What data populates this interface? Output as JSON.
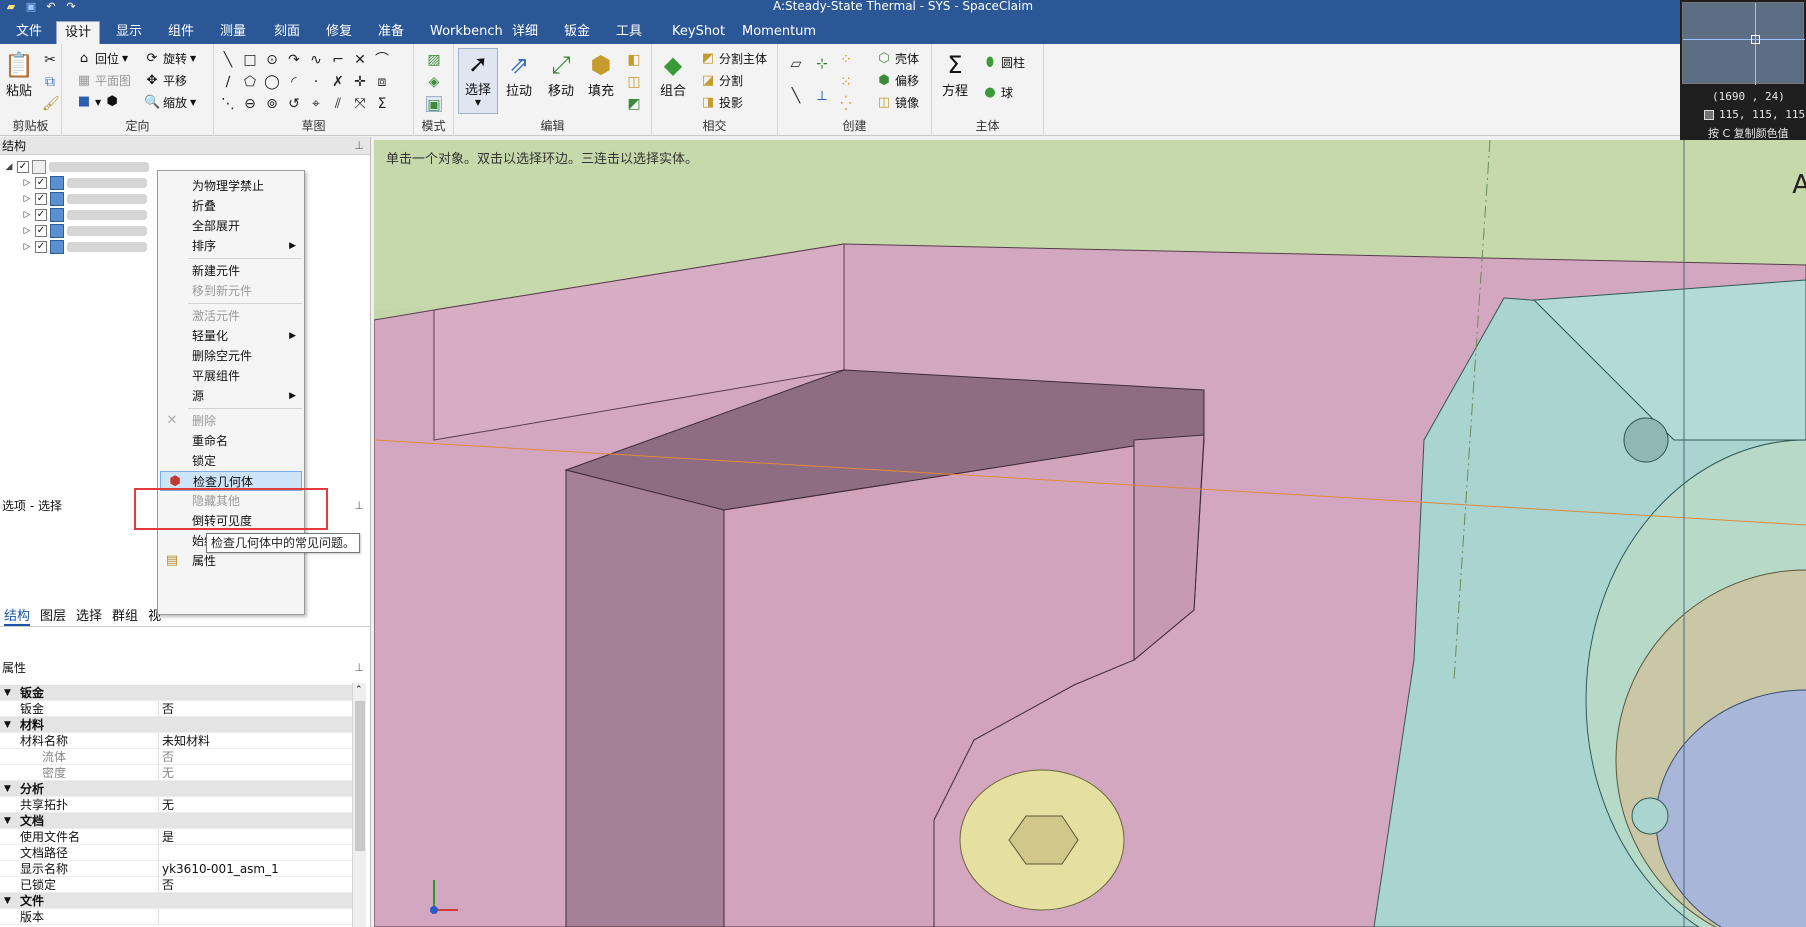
{
  "window": {
    "title": "A:Steady-State Thermal - SYS - SpaceClaim"
  },
  "ribbon_tabs": [
    "文件",
    "设计",
    "显示",
    "组件",
    "测量",
    "刻面",
    "修复",
    "准备",
    "Workbench",
    "详细",
    "钣金",
    "工具",
    "KeyShot",
    "Momentum"
  ],
  "active_tab": "设计",
  "ribbon": {
    "clipboard": {
      "caption": "剪贴板",
      "paste": "粘贴"
    },
    "orient": {
      "caption": "定向",
      "home": "回位",
      "plane": "平面图",
      "rotate": "旋转",
      "pan": "平移",
      "zoom": "缩放"
    },
    "sketch": {
      "caption": "草图"
    },
    "mode": {
      "caption": "模式"
    },
    "edit": {
      "caption": "编辑",
      "select": "选择",
      "pull": "拉动",
      "move": "移动",
      "fill": "填充"
    },
    "intersect": {
      "caption": "相交",
      "combine": "组合",
      "split_body": "分割主体",
      "split": "分割",
      "project": "投影"
    },
    "create": {
      "caption": "创建",
      "shell": "壳体",
      "offset": "偏移",
      "mirror": "镜像"
    },
    "body": {
      "caption": "主体",
      "equation": "方程",
      "cylinder": "圆柱",
      "sphere": "球"
    }
  },
  "inset": {
    "coords": "(1690 , 24)",
    "color_value": "115, 115, 115",
    "copy_hint": "按 C 复制颜色值"
  },
  "structure_panel": {
    "title": "结构",
    "pin": "⊥"
  },
  "panel_tabs": [
    "结构",
    "图层",
    "选择",
    "群组",
    "视"
  ],
  "options_panel": {
    "title": "选项 - 选择"
  },
  "properties_panel": {
    "title": "属性",
    "rows": [
      {
        "type": "cat",
        "k": "钣金",
        "v": ""
      },
      {
        "type": "row",
        "k": "钣金",
        "v": "否"
      },
      {
        "type": "cat",
        "k": "材料",
        "v": ""
      },
      {
        "type": "row",
        "k": "材料名称",
        "v": "未知材料"
      },
      {
        "type": "dim",
        "k": "流体",
        "v": "否"
      },
      {
        "type": "dim",
        "k": "密度",
        "v": "无"
      },
      {
        "type": "cat",
        "k": "分析",
        "v": ""
      },
      {
        "type": "row",
        "k": "共享拓扑",
        "v": "无"
      },
      {
        "type": "cat",
        "k": "文档",
        "v": ""
      },
      {
        "type": "row",
        "k": "使用文件名",
        "v": "是"
      },
      {
        "type": "row",
        "k": "文档路径",
        "v": ""
      },
      {
        "type": "row",
        "k": "显示名称",
        "v": "yk3610-001_asm_1"
      },
      {
        "type": "row",
        "k": "已锁定",
        "v": "否"
      },
      {
        "type": "cat",
        "k": "文件",
        "v": ""
      },
      {
        "type": "row",
        "k": "版本",
        "v": ""
      }
    ]
  },
  "viewport": {
    "hint": "单击一个对象。双击以选择环边。三连击以选择实体。",
    "corner": "A"
  },
  "context_menu": {
    "items": [
      {
        "label": "为物理学禁止",
        "disabled": false
      },
      {
        "label": "折叠",
        "disabled": false
      },
      {
        "label": "全部展开",
        "disabled": false
      },
      {
        "label": "排序",
        "disabled": false,
        "submenu": true
      },
      {
        "sep": true
      },
      {
        "label": "新建元件",
        "disabled": false
      },
      {
        "label": "移到新元件",
        "disabled": true
      },
      {
        "sep": true
      },
      {
        "label": "激活元件",
        "disabled": true
      },
      {
        "label": "轻量化",
        "disabled": false,
        "submenu": true
      },
      {
        "label": "删除空元件",
        "disabled": false
      },
      {
        "label": "平展组件",
        "disabled": false
      },
      {
        "label": "源",
        "disabled": false,
        "submenu": true
      },
      {
        "sep": true
      },
      {
        "label": "删除",
        "disabled": true,
        "icon": "delete-icon"
      },
      {
        "label": "重命名",
        "disabled": false
      },
      {
        "label": "锁定",
        "disabled": false
      },
      {
        "label": "检查几何体",
        "disabled": false,
        "hot": true,
        "icon": "check-geometry-icon"
      },
      {
        "label": "隐藏其他",
        "disabled": true
      },
      {
        "label": "倒转可见度",
        "disabled": false
      },
      {
        "label": "始终可见",
        "disabled": false
      },
      {
        "label": "属性",
        "disabled": false,
        "icon": "properties-icon"
      }
    ],
    "tooltip": "检查几何体中的常见问题。"
  },
  "colors": {
    "titlebar": "#2b5797",
    "highlight": "#cde4f7",
    "red_annotation": "#e23b3b"
  }
}
